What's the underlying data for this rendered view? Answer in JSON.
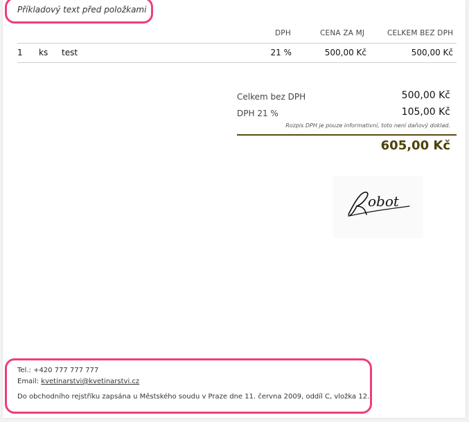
{
  "intro_text": "Příkladový text před položkami",
  "table": {
    "headers": {
      "vat": "DPH",
      "unit_price": "CENA ZA MJ",
      "total_excl_vat": "CELKEM BEZ DPH"
    },
    "rows": [
      {
        "quantity": "1",
        "unit": "ks",
        "description": "test",
        "vat": "21 %",
        "unit_price": "500,00 Kč",
        "total_excl_vat": "500,00 Kč"
      }
    ]
  },
  "summary": {
    "subtotal_label": "Celkem bez DPH",
    "subtotal_value": "500,00 Kč",
    "vat_label": "DPH 21 %",
    "vat_value": "105,00 Kč",
    "note": "Rozpis DPH je pouze informativní, toto není daňový doklad.",
    "total": "605,00 Kč"
  },
  "signature": {
    "text": "Robot"
  },
  "footer": {
    "phone_line": "Tel.: +420 777 777 777",
    "email_label": "Email: ",
    "email": "kvetinarstvi@kvetinarstvi.cz",
    "registry": "Do obchodního rejstříku zapsána u Městského soudu v Praze dne 11. června 2009, oddíl C, vložka 12."
  },
  "colors": {
    "highlight": "#ec3f75",
    "total": "#4d4208"
  }
}
